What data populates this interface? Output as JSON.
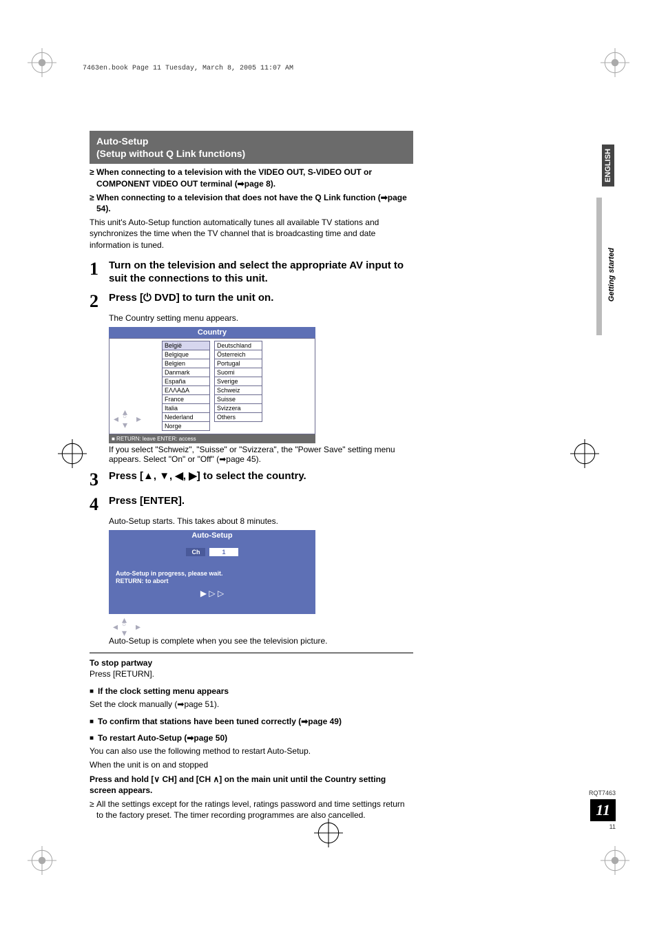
{
  "printmark": "7463en.book  Page 11  Tuesday, March 8, 2005  11:07 AM",
  "tabs": {
    "english": "ENGLISH",
    "getting": "Getting started"
  },
  "heading": {
    "line1": "Auto-Setup",
    "line2": "(Setup without Q Link functions)"
  },
  "intro": {
    "b1": "When connecting to a television with the VIDEO OUT, S-VIDEO OUT or COMPONENT VIDEO OUT terminal (➡page 8).",
    "b2": "When connecting to a television that does not have the Q Link function (➡page 54).",
    "para": "This unit's Auto-Setup function automatically tunes all available TV stations and synchronizes the time when the TV channel that is broadcasting time and date information is tuned."
  },
  "steps": {
    "s1": {
      "num": "1",
      "text": "Turn on the television and select the appropriate AV input to suit the connections to this unit."
    },
    "s2": {
      "num": "2",
      "text": "Press [⏻ DVD] to turn the unit on.",
      "sub": "The Country setting menu appears."
    },
    "s3": {
      "num": "3",
      "text": "Press [▲, ▼, ◀, ▶] to select the country."
    },
    "s4": {
      "num": "4",
      "text": "Press [ENTER].",
      "sub": "Auto-Setup starts. This takes about 8 minutes.",
      "sub2": "Auto-Setup is complete when you see the television picture."
    }
  },
  "country_osd": {
    "title": "Country",
    "left": [
      "België",
      "Belgique",
      "Belgien",
      "Danmark",
      "España",
      "ΕΛΛΑΔΑ",
      "France",
      "Italia",
      "Nederland",
      "Norge"
    ],
    "right": [
      "Deutschland",
      "Österreich",
      "Portugal",
      "Suomi",
      "Sverige",
      "Schweiz",
      "Suisse",
      "Svizzera",
      "Others"
    ],
    "footer": "■  RETURN: leave   ENTER: access",
    "after": "If you select \"Schweiz\", \"Suisse\" or \"Svizzera\", the \"Power Save\" setting menu appears. Select \"On\" or \"Off\" (➡page 45)."
  },
  "auto_osd": {
    "title": "Auto-Setup",
    "ch_label": "Ch",
    "ch_value": "1",
    "line1": "Auto-Setup in progress, please wait.",
    "line2": "RETURN:  to abort",
    "play": "▶ ▷ ▷"
  },
  "stop": {
    "head": "To stop partway",
    "body": "Press [RETURN]."
  },
  "clock": {
    "head": "If the clock setting menu appears",
    "body": "Set the clock manually (➡page 51)."
  },
  "confirm": {
    "head": "To confirm that stations have been tuned correctly (➡page 49)"
  },
  "restart": {
    "head": "To restart Auto-Setup (➡page 50)",
    "p1": "You can also use the following method to restart Auto-Setup.",
    "p2": "When the unit is on and stopped",
    "p3": "Press and hold [∨ CH] and [CH ∧] on the main unit until the Country setting screen appears.",
    "p4": "All the settings except for the ratings level, ratings password and time settings return to the factory preset. The timer recording programmes are also cancelled."
  },
  "footer": {
    "docid": "RQT7463",
    "page": "11",
    "subpage": "11"
  }
}
